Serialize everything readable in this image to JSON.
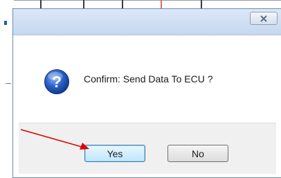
{
  "dialog": {
    "close_glyph": "☒",
    "message": "Confirm: Send Data To ECU ?",
    "icon": "question-icon",
    "buttons": {
      "yes_label": "Yes",
      "no_label": "No"
    }
  },
  "colors": {
    "titlebar": "#c5d8ef",
    "accent_button": "#bee6fd",
    "annotation_arrow": "#e00000"
  }
}
